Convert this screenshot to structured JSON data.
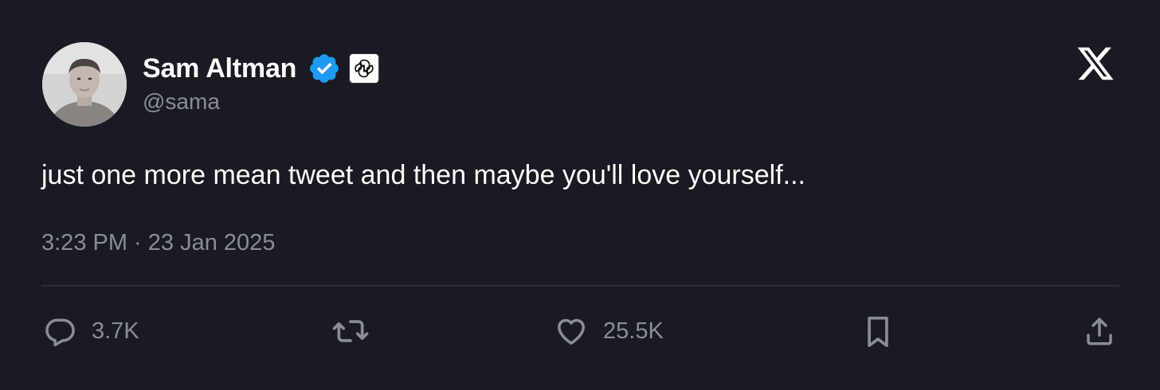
{
  "author": {
    "display_name": "Sam Altman",
    "handle": "@sama",
    "verified_badge_color": "#1d9bf0",
    "affiliate_badge_icon": "openai-logo-icon"
  },
  "tweet": {
    "text": "just one more mean tweet and then maybe you'll love yourself...",
    "timestamp": "3:23 PM · 23 Jan 2025"
  },
  "actions": {
    "reply": {
      "icon": "reply-icon",
      "count": "3.7K"
    },
    "retweet": {
      "icon": "retweet-icon",
      "count": ""
    },
    "like": {
      "icon": "heart-icon",
      "count": "25.5K"
    },
    "bookmark": {
      "icon": "bookmark-icon"
    },
    "share": {
      "icon": "share-icon"
    }
  },
  "platform_logo": "x-logo-icon",
  "colors": {
    "background": "#191a23",
    "primary_text": "#ffffff",
    "secondary_text": "#8b8d96",
    "divider": "#2c2d36"
  }
}
